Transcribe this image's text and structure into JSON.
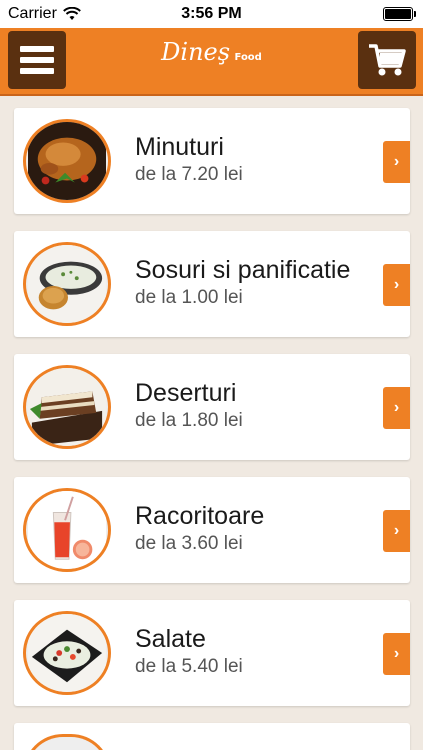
{
  "status_bar": {
    "carrier": "Carrier",
    "time": "3:56 PM"
  },
  "header": {
    "logo_text": "Dineş",
    "logo_sub": "Food",
    "menu_icon": "hamburger-icon",
    "cart_icon": "cart-icon"
  },
  "theme": {
    "accent": "#ee8024",
    "button_dark": "#5a3010",
    "background": "#f0e9e1"
  },
  "categories": [
    {
      "title": "Minuturi",
      "price": "de la 7.20 lei",
      "icon": "roast-chicken-icon"
    },
    {
      "title": "Sosuri si panificatie",
      "price": "de la 1.00 lei",
      "icon": "sauce-bread-icon"
    },
    {
      "title": "Deserturi",
      "price": "de la 1.80 lei",
      "icon": "cake-icon"
    },
    {
      "title": "Racoritoare",
      "price": "de la 3.60 lei",
      "icon": "juice-glass-icon"
    },
    {
      "title": "Salate",
      "price": "de la 5.40 lei",
      "icon": "salad-plate-icon"
    }
  ]
}
